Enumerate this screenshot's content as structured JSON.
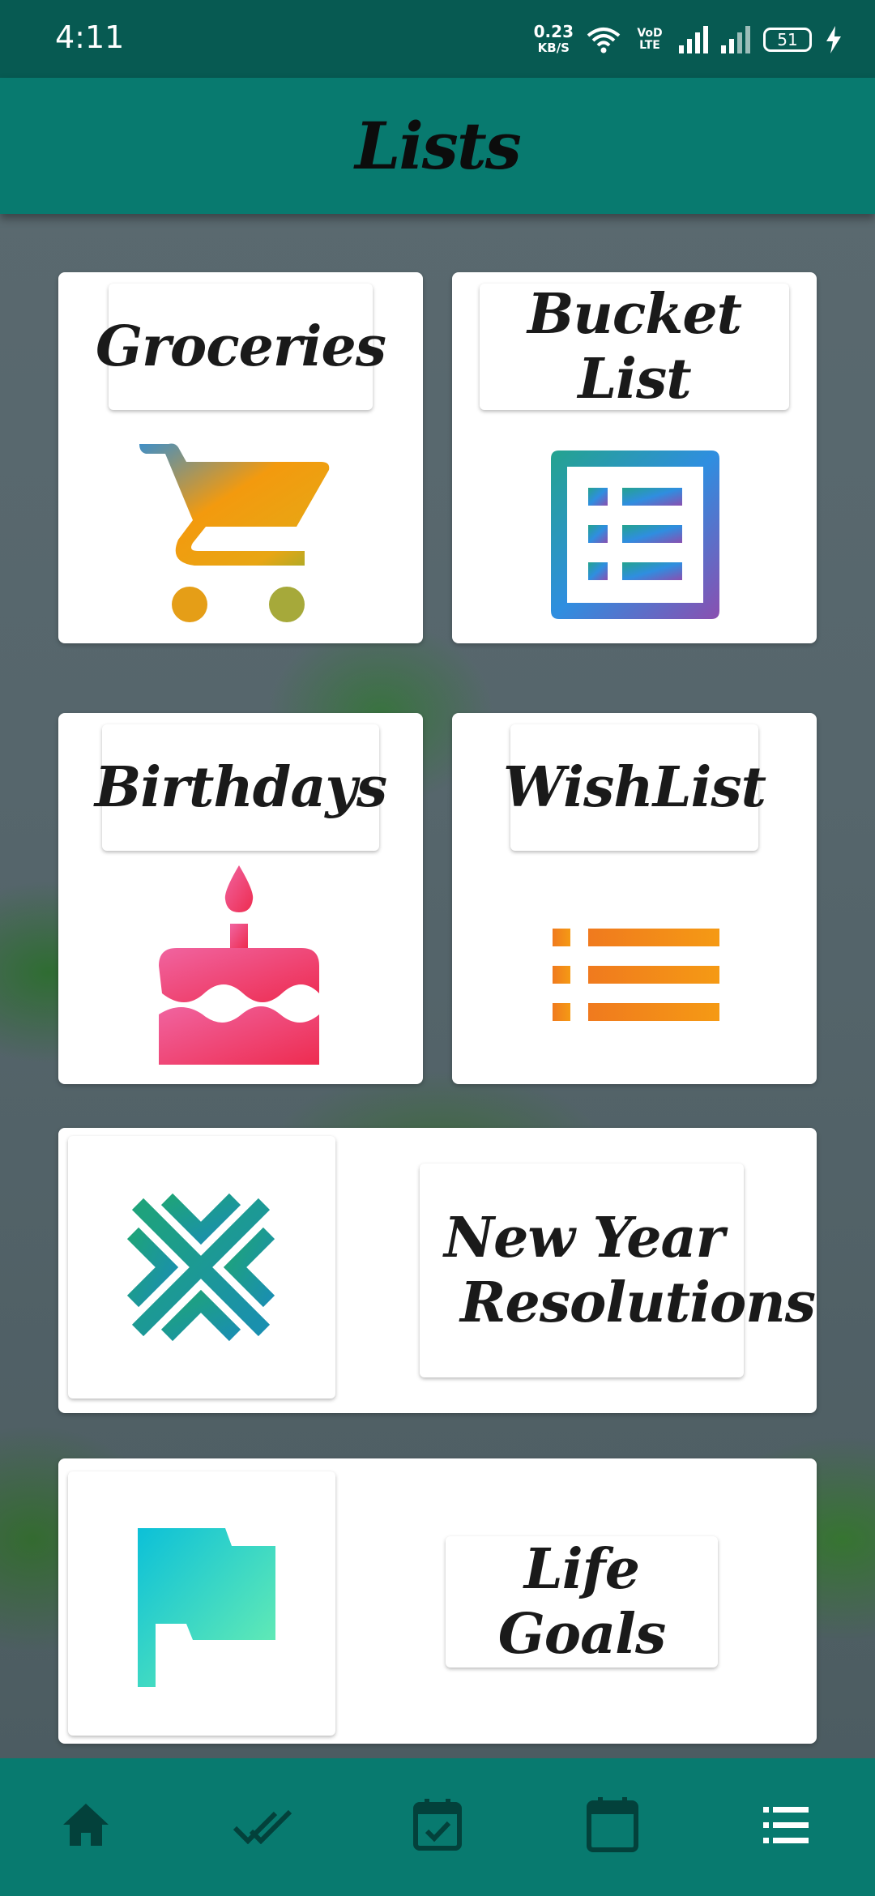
{
  "status_bar": {
    "time": "4:11",
    "net_speed_value": "0.23",
    "net_speed_unit": "KB/S",
    "carrier": "VoD LTE",
    "battery": "51",
    "icons": [
      "wifi-icon",
      "signal-icon",
      "battery-icon",
      "charging-icon"
    ]
  },
  "app_bar": {
    "title": "Lists"
  },
  "lists": [
    {
      "label": "Groceries",
      "icon": "shopping-cart-icon"
    },
    {
      "label": "Bucket List",
      "icon": "list-box-icon"
    },
    {
      "label": "Birthdays",
      "icon": "cake-icon"
    },
    {
      "label": "WishList",
      "icon": "bulleted-list-icon"
    },
    {
      "label_line1": "New Year",
      "label_line2": "Resolutions",
      "icon": "snowflake-icon"
    },
    {
      "label": "Life Goals",
      "icon": "flag-icon"
    }
  ],
  "bottom_nav": {
    "items": [
      "home-icon",
      "done-all-icon",
      "event-check-icon",
      "calendar-icon",
      "list-icon"
    ],
    "active": "list-icon"
  },
  "colors": {
    "status_bar": "#075a52",
    "app_bar": "#087a6f",
    "card": "#ffffff",
    "nav_icon": "#03413b",
    "nav_icon_active": "#ffffff"
  }
}
